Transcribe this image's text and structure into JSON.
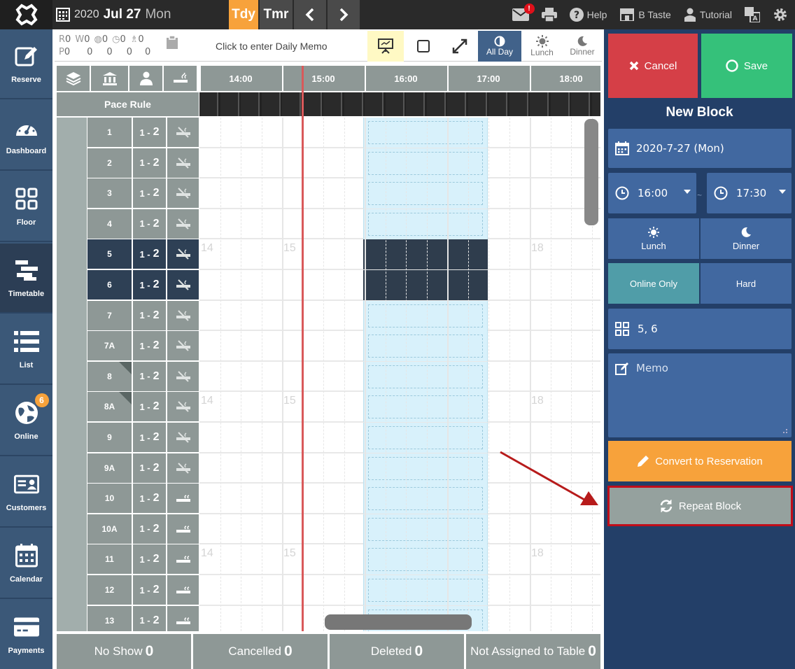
{
  "topbar": {
    "year": "2020",
    "month_day": "Jul 27",
    "weekday": "Mon",
    "today_label": "Tdy",
    "tomorrow_label": "Tmr",
    "mail_badge": "!",
    "help_label": "Help",
    "store_label": "B Taste",
    "tutorial_label": "Tutorial"
  },
  "sidebar": {
    "items": [
      {
        "label": "Reserve"
      },
      {
        "label": "Dashboard"
      },
      {
        "label": "Floor"
      },
      {
        "label": "Timetable"
      },
      {
        "label": "List"
      },
      {
        "label": "Online",
        "badge": "6"
      },
      {
        "label": "Customers"
      },
      {
        "label": "Calendar"
      },
      {
        "label": "Payments"
      }
    ]
  },
  "stats": {
    "r": "R",
    "r_val": "0",
    "w": "W",
    "w_val": "0",
    "v1": "0",
    "v2": "0",
    "v3": "0",
    "p": "P",
    "p_val": "0",
    "p1": "0",
    "p2": "0",
    "p3": "0",
    "p4": "0"
  },
  "controls": {
    "memo_placeholder": "Click to enter Daily Memo",
    "allday_label": "All Day",
    "lunch_label": "Lunch",
    "dinner_label": "Dinner"
  },
  "timetable": {
    "pace_rule_label": "Pace Rule",
    "times": [
      "14:00",
      "15:00",
      "16:00",
      "17:00",
      "18:00"
    ],
    "ghost_hours": [
      "14",
      "15",
      "18"
    ],
    "rows": [
      {
        "table": "1",
        "pax_min": "1 -",
        "pax_max": "2",
        "smoking": false
      },
      {
        "table": "2",
        "pax_min": "1 -",
        "pax_max": "2",
        "smoking": false
      },
      {
        "table": "3",
        "pax_min": "1 -",
        "pax_max": "2",
        "smoking": false
      },
      {
        "table": "4",
        "pax_min": "1 -",
        "pax_max": "2",
        "smoking": false
      },
      {
        "table": "5",
        "pax_min": "1 -",
        "pax_max": "2",
        "smoking": false
      },
      {
        "table": "6",
        "pax_min": "1 -",
        "pax_max": "2",
        "smoking": false
      },
      {
        "table": "7",
        "pax_min": "1 -",
        "pax_max": "2",
        "smoking": false
      },
      {
        "table": "7A",
        "pax_min": "1 -",
        "pax_max": "2",
        "smoking": false
      },
      {
        "table": "8",
        "pax_min": "1 -",
        "pax_max": "2",
        "smoking": false
      },
      {
        "table": "8A",
        "pax_min": "1 -",
        "pax_max": "2",
        "smoking": false
      },
      {
        "table": "9",
        "pax_min": "1 -",
        "pax_max": "2",
        "smoking": false
      },
      {
        "table": "9A",
        "pax_min": "1 -",
        "pax_max": "2",
        "smoking": false
      },
      {
        "table": "10",
        "pax_min": "1 -",
        "pax_max": "2",
        "smoking": true
      },
      {
        "table": "10A",
        "pax_min": "1 -",
        "pax_max": "2",
        "smoking": true
      },
      {
        "table": "11",
        "pax_min": "1 -",
        "pax_max": "2",
        "smoking": true
      },
      {
        "table": "12",
        "pax_min": "1 -",
        "pax_max": "2",
        "smoking": true
      },
      {
        "table": "13",
        "pax_min": "1 -",
        "pax_max": "2",
        "smoking": true
      }
    ]
  },
  "bottom": {
    "no_show_label": "No Show",
    "no_show_val": "0",
    "cancelled_label": "Cancelled",
    "cancelled_val": "0",
    "deleted_label": "Deleted",
    "deleted_val": "0",
    "unassigned_label": "Not Assigned to Table",
    "unassigned_val": "0"
  },
  "panel": {
    "cancel_label": "Cancel",
    "save_label": "Save",
    "title": "New Block",
    "date": "2020-7-27 (Mon)",
    "start_time": "16:00",
    "end_time": "17:30",
    "tilde": "~",
    "lunch_label": "Lunch",
    "dinner_label": "Dinner",
    "online_only_label": "Online Only",
    "hard_label": "Hard",
    "tables": "5, 6",
    "memo_placeholder": "Memo",
    "convert_label": "Convert to Reservation",
    "repeat_label": "Repeat Block"
  },
  "colors": {
    "accent_orange": "#f7a23b",
    "panel_blue": "#233f68",
    "field_blue": "#4168a0",
    "cancel_red": "#d53f47",
    "save_green": "#35c17a",
    "highlight_red": "#c10d1a"
  }
}
